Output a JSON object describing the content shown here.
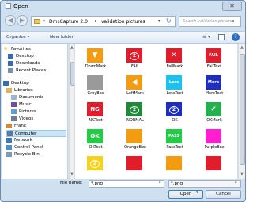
{
  "window": {
    "title": "Open",
    "close_glyph": "✕"
  },
  "nav": {
    "back_glyph": "◀",
    "forward_glyph": "▶"
  },
  "address": {
    "separator": "«",
    "arrow": "▸",
    "crumbs": [
      "DmsCapture 2.0",
      "validation pictures"
    ],
    "dropdown": "▾",
    "refresh_glyph": "↻"
  },
  "search": {
    "placeholder": "Search validation pictures",
    "icon": "search-icon"
  },
  "toolbar": {
    "organize": "Organize ▾",
    "new_folder": "New folder",
    "view_glyph": "≡ ▾",
    "help": "?"
  },
  "sidebar": {
    "items": [
      {
        "label": "Favorites",
        "icon": "star-icon"
      },
      {
        "label": "Desktop",
        "icon": "desktop-icon"
      },
      {
        "label": "Downloads",
        "icon": "downloads-icon"
      },
      {
        "label": "Recent Places",
        "icon": "recent-places-icon"
      },
      {
        "label": "Desktop",
        "icon": "desktop-icon"
      },
      {
        "label": "Libraries",
        "icon": "libraries-icon"
      },
      {
        "label": "Documents",
        "icon": "documents-icon"
      },
      {
        "label": "Music",
        "icon": "music-icon"
      },
      {
        "label": "Pictures",
        "icon": "pictures-icon"
      },
      {
        "label": "Videos",
        "icon": "videos-icon"
      },
      {
        "label": "Frank",
        "icon": "user-icon"
      },
      {
        "label": "Computer",
        "icon": "computer-icon"
      },
      {
        "label": "Network",
        "icon": "network-icon"
      },
      {
        "label": "Control Panel",
        "icon": "control-panel-icon"
      },
      {
        "label": "Recycle Bin",
        "icon": "recycle-bin-icon"
      }
    ]
  },
  "files": [
    {
      "name": "DownMark",
      "bg": "#f39c12",
      "glyph": "▼",
      "glyph_color": "#ffffff"
    },
    {
      "name": "FAIL",
      "bg": "#e11d2b",
      "glyph": "2",
      "glyph_color": "#ffffff"
    },
    {
      "name": "FailMark",
      "bg": "#e11d2b",
      "glyph": "✕",
      "glyph_color": "#ffffff"
    },
    {
      "name": "FailText",
      "bg": "#e11d2b",
      "glyph": "FAIL",
      "glyph_color": "#ffffff"
    },
    {
      "name": "GreyBox",
      "bg": "#9a9a9a",
      "glyph": "",
      "glyph_color": "#ffffff"
    },
    {
      "name": "LeftMark",
      "bg": "#f39c12",
      "glyph": "◀",
      "glyph_color": "#ffffff"
    },
    {
      "name": "LessText",
      "bg": "#19c2f0",
      "glyph": "Less",
      "glyph_color": "#ffffff"
    },
    {
      "name": "MoreText",
      "bg": "#1e2fbf",
      "glyph": "More",
      "glyph_color": "#ffffff"
    },
    {
      "name": "NGText",
      "bg": "#e11d2b",
      "glyph": "NG",
      "glyph_color": "#ffffff"
    },
    {
      "name": "NORMAL",
      "bg": "#1f8a3a",
      "glyph": "2",
      "glyph_color": "#ffffff"
    },
    {
      "name": "OK",
      "bg": "#1e2fbf",
      "glyph": "2",
      "glyph_color": "#ffffff"
    },
    {
      "name": "OKMark",
      "bg": "#22b14c",
      "glyph": "✔",
      "glyph_color": "#ffffff"
    },
    {
      "name": "OKText",
      "bg": "#22cc44",
      "glyph": "OK",
      "glyph_color": "#ffffff"
    },
    {
      "name": "OrangeBox",
      "bg": "#f39c12",
      "glyph": "",
      "glyph_color": "#ffffff"
    },
    {
      "name": "PassText",
      "bg": "#22cc44",
      "glyph": "PASS",
      "glyph_color": "#ffffff"
    },
    {
      "name": "PurpleBox",
      "bg": "#ff1fd0",
      "glyph": "",
      "glyph_color": "#ffffff"
    },
    {
      "name": "",
      "bg": "#f7d21a",
      "glyph": "2",
      "glyph_color": "#ffffff"
    },
    {
      "name": "",
      "bg": "#e11d2b",
      "glyph": "",
      "glyph_color": "#ffffff"
    },
    {
      "name": "",
      "bg": "#f39c12",
      "glyph": "",
      "glyph_color": "#ffffff"
    },
    {
      "name": "",
      "bg": "#e11d2b",
      "glyph": "",
      "glyph_color": "#ffffff"
    }
  ],
  "bottom": {
    "filename_label": "File name:",
    "filename_value": "*.png",
    "filetype_value": "*.png",
    "open_label": "Open",
    "open_split": "▾",
    "cancel_label": "Cancel",
    "dropdown": "▾"
  }
}
